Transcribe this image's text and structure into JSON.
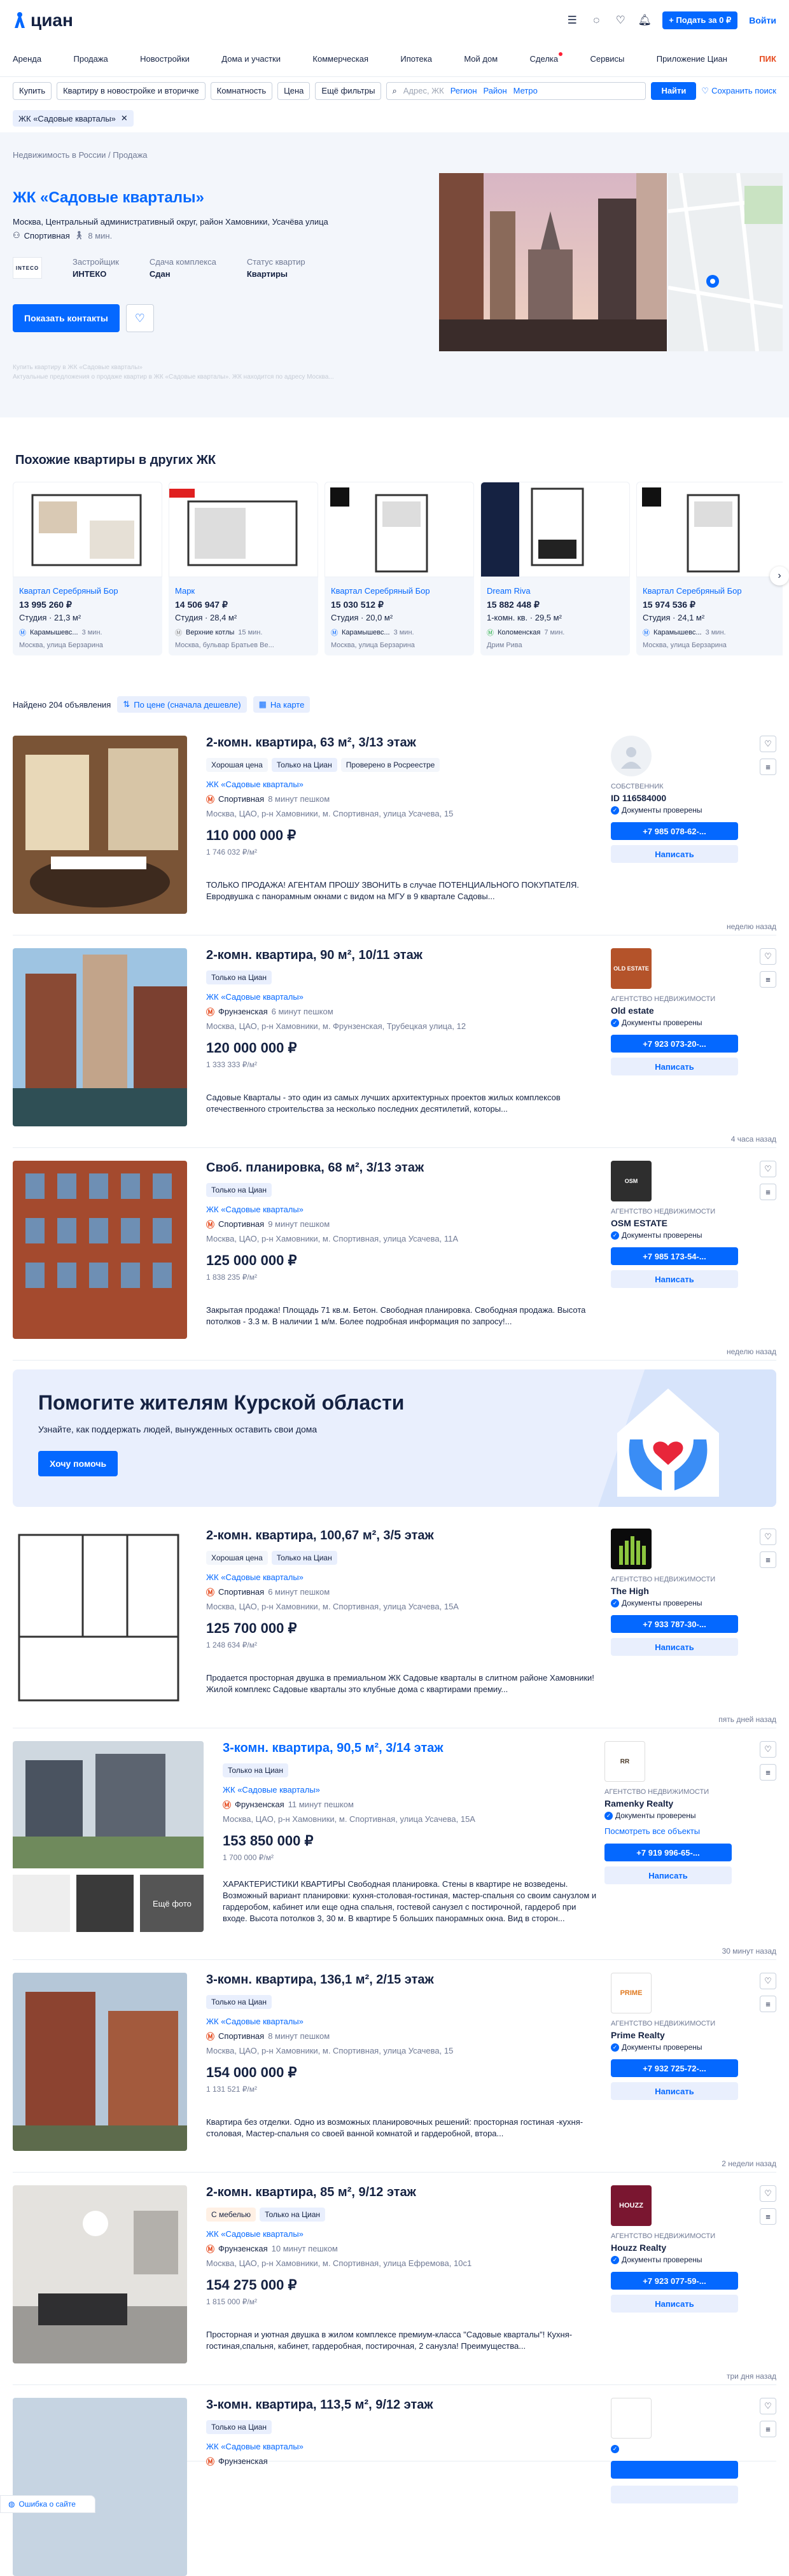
{
  "header": {
    "logo": "циан",
    "post_ad": "+ Подать за 0 ₽",
    "login": "Войти"
  },
  "nav": [
    "Аренда",
    "Продажа",
    "Новостройки",
    "Дома и участки",
    "Коммерческая",
    "Ипотека",
    "Мой дом",
    "Сделка",
    "Сервисы",
    "Приложение Циан",
    "ПИК"
  ],
  "filters": {
    "buy": "Купить",
    "type": "Квартиру в новостройке и вторичке",
    "rooms": "Комнатность",
    "price": "Цена",
    "more": "Ещё фильтры",
    "search_placeholder": "Адрес, ЖК",
    "region": "Регион",
    "district": "Район",
    "metro": "Метро",
    "find": "Найти",
    "save_search": "Сохранить поиск"
  },
  "tag": "ЖК «Садовые кварталы»",
  "complex": {
    "breadcrumbs": "Недвижимость в России / Продажа",
    "title": "ЖК «Садовые кварталы»",
    "address": "Москва, Центральный административный округ, район Хамовники, Усачёва улица",
    "metro": "Спортивная",
    "walk": "8 мин.",
    "developer_logo": "INTECO",
    "facts": [
      {
        "k": "Застройщик",
        "v": "ИНТЕКО"
      },
      {
        "k": "Сдача комплекса",
        "v": "Сдан"
      },
      {
        "k": "Статус квартир",
        "v": "Квартиры"
      }
    ],
    "show_contacts": "Показать контакты",
    "note1": "Купить квартиру в ЖК «Садовые кварталы»",
    "note2": "Актуальные предложения о продаже квартир в ЖК «Садовые кварталы». ЖК находится по адресу Москва..."
  },
  "similar": {
    "title": "Похожие квартиры в других ЖК",
    "cards": [
      {
        "name": "Квартал Серебряный Бор",
        "price": "13 995 260 ₽",
        "area": "Студия · 21,3 м²",
        "metro": "Карамышевс...",
        "walk": "3 мин.",
        "address": "Москва, улица Берзарина"
      },
      {
        "name": "Марк",
        "price": "14 506 947 ₽",
        "area": "Студия · 28,4 м²",
        "metro": "Верхние котлы",
        "walk": "15 мин.",
        "address": "Москва, бульвар Братьев Ве..."
      },
      {
        "name": "Квартал Серебряный Бор",
        "price": "15 030 512 ₽",
        "area": "Студия · 20,0 м²",
        "metro": "Карамышевс...",
        "walk": "3 мин.",
        "address": "Москва, улица Берзарина"
      },
      {
        "name": "Dream Riva",
        "price": "15 882 448 ₽",
        "area": "1-комн. кв. · 29,5 м²",
        "metro": "Коломенская",
        "walk": "7 мин.",
        "address": "Дрим Рива"
      },
      {
        "name": "Квартал Серебряный Бор",
        "price": "15 974 536 ₽",
        "area": "Студия · 24,1 м²",
        "metro": "Карамышевс...",
        "walk": "3 мин.",
        "address": "Москва, улица Берзарина"
      }
    ]
  },
  "results": {
    "count": "Найдено 204 объявления",
    "sort": "По цене (сначала дешевле)",
    "map": "На карте"
  },
  "offers": [
    {
      "title": "2-комн. квартира, 63 м², 3/13 этаж",
      "badges": [
        "Хорошая цена",
        "Только на Циан",
        "Проверено в Росреестре"
      ],
      "jk": "ЖК «Садовые кварталы»",
      "metro": "Спортивная",
      "walk": "8 минут пешком",
      "address": "Москва, ЦАО, р-н Хамовники, м. Спортивная, улица Усачева, 15",
      "price": "110 000 000 ₽",
      "ppm": "1 746 032 ₽/м²",
      "desc": "ТОЛЬКО ПРОДАЖА! АГЕНТАМ ПРОШУ ЗВОНИТЬ в случае ПОТЕНЦИАЛЬНОГО ПОКУПАТЕЛЯ. Евродвушка с панорамным окнами с видом на МГУ в 9 квартале Садовы...",
      "time": "неделю назад",
      "seller_type": "собственник",
      "seller_name": "ID 116584000",
      "docs": "Документы проверены",
      "phone": "+7 985 078-62-...",
      "write": "Написать"
    },
    {
      "title": "2-комн. квартира, 90 м², 10/11 этаж",
      "badges": [
        "Только на Циан"
      ],
      "jk": "ЖК «Садовые кварталы»",
      "metro": "Фрунзенская",
      "walk": "6 минут пешком",
      "address": "Москва, ЦАО, р-н Хамовники, м. Фрунзенская, Трубецкая улица, 12",
      "price": "120 000 000 ₽",
      "ppm": "1 333 333 ₽/м²",
      "desc": "Садовые Кварталы - это один из самых лучших архитектурных проектов жилых комплексов отечественного строительства за несколько последних десятилетий, которы...",
      "time": "4 часа назад",
      "seller_type": "агентство недвижимости",
      "seller_name": "Old estate",
      "docs": "Документы проверены",
      "phone": "+7 923 073-20-...",
      "write": "Написать"
    },
    {
      "title": "Своб. планировка, 68 м², 3/13 этаж",
      "badges": [
        "Только на Циан"
      ],
      "jk": "ЖК «Садовые кварталы»",
      "metro": "Спортивная",
      "walk": "9 минут пешком",
      "address": "Москва, ЦАО, р-н Хамовники, м. Спортивная, улица Усачева, 11А",
      "price": "125 000 000 ₽",
      "ppm": "1 838 235 ₽/м²",
      "desc": "Закрытая продажа! Площадь 71 кв.м. Бетон. Свободная планировка. Свободная продажа. Высота потолков - 3.3 м. В наличии 1 м/м. Более подробная информация по запросу!...",
      "time": "неделю назад",
      "seller_type": "агентство недвижимости",
      "seller_name": "OSM ESTATE",
      "docs": "Документы проверены",
      "phone": "+7 985 173-54-...",
      "write": "Написать"
    },
    {
      "title": "2-комн. квартира, 100,67 м², 3/5 этаж",
      "badges": [
        "Хорошая цена",
        "Только на Циан"
      ],
      "jk": "ЖК «Садовые кварталы»",
      "metro": "Спортивная",
      "walk": "6 минут пешком",
      "address": "Москва, ЦАО, р-н Хамовники, м. Спортивная, улица Усачева, 15А",
      "price": "125 700 000 ₽",
      "ppm": "1 248 634 ₽/м²",
      "desc": "Продается просторная двушка в премиальном ЖК Садовые кварталы в слитном районе Хамовники! Жилой комплекс Садовые кварталы это клубные дома с квартирами премиу...",
      "time": "пять дней назад",
      "seller_type": "агентство недвижимости",
      "seller_name": "The High",
      "docs": "Документы проверены",
      "phone": "+7 933 787-30-...",
      "write": "Написать"
    },
    {
      "title": "3-комн. квартира, 90,5 м², 3/14 этаж",
      "badges": [
        "Только на Циан"
      ],
      "jk": "ЖК «Садовые кварталы»",
      "metro": "Фрунзенская",
      "walk": "11 минут пешком",
      "address": "Москва, ЦАО, р-н Хамовники, м. Спортивная, улица Усачева, 15А",
      "price": "153 850 000 ₽",
      "ppm": "1 700 000 ₽/м²",
      "desc": "ХАРАКТЕРИСТИКИ КВАРТИРЫ Свободная планировка. Стены в квартире не возведены. Возможный вариант планировки: кухня-столовая-гостиная, мастер-спальня со своим санузлом и гардеробом, кабинет или еще одна спальня, гостевой санузел с постирочной, гардероб при входе. Высота потолков 3, 30 м. В квартире 5 больших панорамных окна. Вид в сторон...",
      "time": "30 минут назад",
      "seller_type": "агентство недвижимости",
      "seller_name": "Ramenky Realty",
      "docs": "Документы проверены",
      "all": "Посмотреть все объекты",
      "phone": "+7 919 996-65-...",
      "write": "Написать",
      "more_photos": "Ещё фото"
    },
    {
      "title": "3-комн. квартира, 136,1 м², 2/15 этаж",
      "badges": [
        "Только на Циан"
      ],
      "jk": "ЖК «Садовые кварталы»",
      "metro": "Спортивная",
      "walk": "8 минут пешком",
      "address": "Москва, ЦАО, р-н Хамовники, м. Спортивная, улица Усачева, 15",
      "price": "154 000 000 ₽",
      "ppm": "1 131 521 ₽/м²",
      "desc": "Квартира без отделки. Одно из возможных планировочных решений: просторная гостиная -кухня-столовая, Мастер-спальня со своей ванной комнатой и гардеробной, втора...",
      "time": "2 недели назад",
      "seller_type": "агентство недвижимости",
      "seller_name": "Prime Realty",
      "docs": "Документы проверены",
      "phone": "+7 932 725-72-...",
      "write": "Написать"
    },
    {
      "title": "2-комн. квартира, 85 м², 9/12 этаж",
      "badges": [
        "С мебелью",
        "Только на Циан"
      ],
      "jk": "ЖК «Садовые кварталы»",
      "metro": "Фрунзенская",
      "walk": "10 минут пешком",
      "address": "Москва, ЦАО, р-н Хамовники, м. Спортивная, улица Ефремова, 10с1",
      "price": "154 275 000 ₽",
      "ppm": "1 815 000 ₽/м²",
      "desc": "Просторная и уютная двушка в жилом комплексе премиум-класса \"Садовые кварталы\"! Кухня-гостиная,спальня, кабинет, гардеробная, постирочная, 2 санузла! Преимущества...",
      "time": "три дня назад",
      "seller_type": "агентство недвижимости",
      "seller_name": "Houzz Realty",
      "docs": "Документы проверены",
      "phone": "+7 923 077-59-...",
      "write": "Написать"
    },
    {
      "title": "3-комн. квартира, 113,5 м², 9/12 этаж",
      "badges": [
        "Только на Циан"
      ],
      "jk": "ЖК «Садовые кварталы»",
      "metro": "Фрунзенская",
      "walk": "",
      "address": "",
      "price": "",
      "ppm": "",
      "desc": "",
      "time": "",
      "seller_type": "",
      "seller_name": "",
      "docs": "",
      "phone": "",
      "write": ""
    }
  ],
  "promo": {
    "title": "Помогите жителям Курской области",
    "text": "Узнайте, как поддержать людей, вынужденных оставить свои дома",
    "button": "Хочу помочь"
  },
  "footer_tab": "Ошибка о сайте"
}
